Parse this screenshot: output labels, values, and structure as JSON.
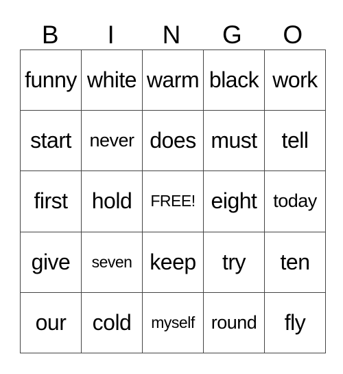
{
  "header": {
    "letters": [
      "B",
      "I",
      "N",
      "G",
      "O"
    ]
  },
  "board": {
    "rows": [
      [
        "funny",
        "white",
        "warm",
        "black",
        "work"
      ],
      [
        "start",
        "never",
        "does",
        "must",
        "tell"
      ],
      [
        "first",
        "hold",
        "FREE!",
        "eight",
        "today"
      ],
      [
        "give",
        "seven",
        "keep",
        "try",
        "ten"
      ],
      [
        "our",
        "cold",
        "myself",
        "round",
        "fly"
      ]
    ],
    "free_space": "FREE!"
  }
}
